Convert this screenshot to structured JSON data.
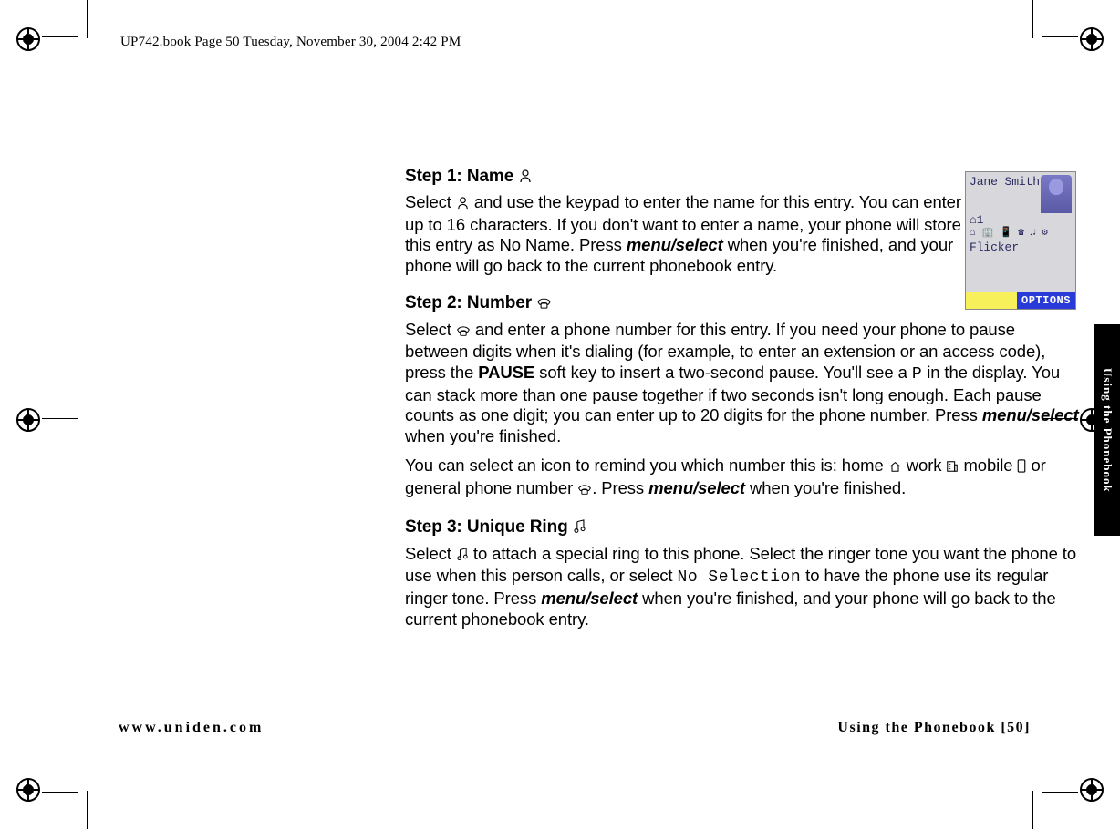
{
  "header": "UP742.book  Page 50  Tuesday, November 30, 2004  2:42 PM",
  "side_tab": "Using the Phonebook",
  "footer": {
    "left": "www.uniden.com",
    "right": "Using the Phonebook [50]"
  },
  "steps": {
    "s1": {
      "title": "Step 1: Name ",
      "p_a": "Select ",
      "p_b": " and use the keypad to enter the name for this entry. You can enter up to 16 characters. If you don't want to enter a name, your phone will store this entry as No Name. Press ",
      "key1": "menu/select",
      "p_c": " when you're finished, and your phone will go back to the current phonebook entry."
    },
    "s2": {
      "title": "Step 2: Number ",
      "p1a": "Select ",
      "p1b": " and enter a phone number for this entry. If you need your phone to pause between digits when it's dialing (for example, to enter an extension or an access code), press the ",
      "pause": "PAUSE",
      "p1c": " soft key to insert a two-second pause. You'll see a ",
      "pchar": "P",
      "p1d": " in the display. You can stack more than one pause together if two seconds isn't long enough. Each pause counts as one digit; you can enter up to 20 digits for the phone number. Press ",
      "key1": "menu/select",
      "p1e": " when you're finished.",
      "p2a": "You can select an icon to remind you which number this is: home ",
      "p2b": " work ",
      "p2c": " mobile ",
      "p2d": " or general phone number ",
      "p2e": ". Press ",
      "key2": "menu/select",
      "p2f": " when you're finished."
    },
    "s3": {
      "title": "Step 3: Unique Ring ",
      "p_a": "Select ",
      "p_b": " to attach a special ring to this phone. Select the ringer tone you want the phone to use when this person calls, or select ",
      "nosel": "No Selection",
      "p_c": " to have the phone use its regular ringer tone. Press ",
      "key1": "menu/select",
      "p_d": " when you're finished, and your phone will go back to the current phonebook entry."
    }
  },
  "phone_shot": {
    "name": "Jane Smith",
    "line2": "⌂1",
    "line3": "⌂ 🏢 📱 ☎ ♫ ⚙",
    "line4": "Flicker",
    "options": "OPTIONS"
  }
}
